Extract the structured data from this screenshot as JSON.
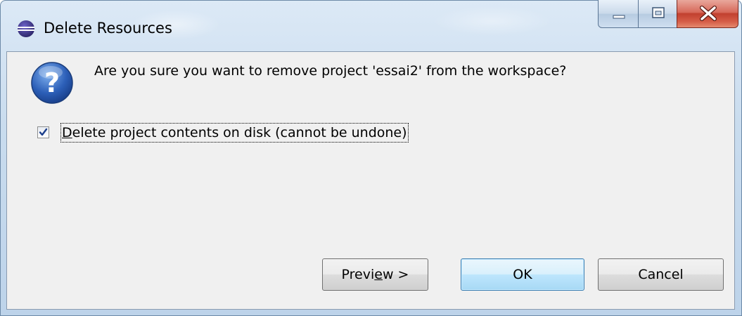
{
  "window": {
    "title": "Delete Resources",
    "icon": "eclipse-icon"
  },
  "controls": {
    "minimize_icon": "minimize-icon",
    "maximize_icon": "maximize-icon",
    "close_icon": "close-icon"
  },
  "dialog": {
    "icon": "question-icon",
    "message": "Are you sure you want to remove project 'essai2' from the workspace?",
    "checkbox": {
      "checked": true,
      "label": "Delete project contents on disk (cannot be undone)",
      "mnemonic_char": "D",
      "label_rest": "elete project contents on disk (cannot be undone)"
    }
  },
  "buttons": {
    "preview": {
      "label": "Preview >",
      "prefix": "Previ",
      "mnemonic": "e",
      "suffix": "w >"
    },
    "ok": {
      "label": "OK"
    },
    "cancel": {
      "label": "Cancel"
    }
  },
  "colors": {
    "close_button": "#c1402f",
    "default_button_border": "#3c7fb1",
    "question_icon": "#2c5fb8"
  }
}
